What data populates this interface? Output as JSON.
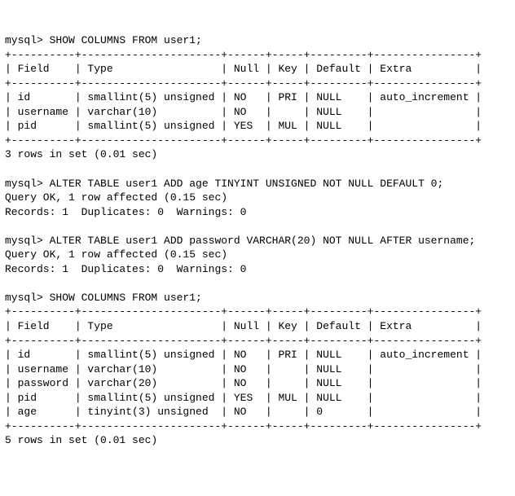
{
  "prompt": "mysql>",
  "sql": {
    "show1": "SHOW COLUMNS FROM user1;",
    "alter1": "ALTER TABLE user1 ADD age TINYINT UNSIGNED NOT NULL DEFAULT 0;",
    "alter2": "ALTER TABLE user1 ADD password VARCHAR(20) NOT NULL AFTER username;",
    "show2": "SHOW COLUMNS FROM user1;"
  },
  "headers": {
    "field": "Field",
    "type": "Type",
    "null": "Null",
    "key": "Key",
    "default": "Default",
    "extra": "Extra"
  },
  "chart_data": [
    {
      "type": "table",
      "title": "SHOW COLUMNS FROM user1 (before ALTER)",
      "columns": [
        "Field",
        "Type",
        "Null",
        "Key",
        "Default",
        "Extra"
      ],
      "rows": [
        {
          "Field": "id",
          "Type": "smallint(5) unsigned",
          "Null": "NO",
          "Key": "PRI",
          "Default": "NULL",
          "Extra": "auto_increment"
        },
        {
          "Field": "username",
          "Type": "varchar(10)",
          "Null": "NO",
          "Key": "",
          "Default": "NULL",
          "Extra": ""
        },
        {
          "Field": "pid",
          "Type": "smallint(5) unsigned",
          "Null": "YES",
          "Key": "MUL",
          "Default": "NULL",
          "Extra": ""
        }
      ]
    },
    {
      "type": "table",
      "title": "SHOW COLUMNS FROM user1 (after ALTER)",
      "columns": [
        "Field",
        "Type",
        "Null",
        "Key",
        "Default",
        "Extra"
      ],
      "rows": [
        {
          "Field": "id",
          "Type": "smallint(5) unsigned",
          "Null": "NO",
          "Key": "PRI",
          "Default": "NULL",
          "Extra": "auto_increment"
        },
        {
          "Field": "username",
          "Type": "varchar(10)",
          "Null": "NO",
          "Key": "",
          "Default": "NULL",
          "Extra": ""
        },
        {
          "Field": "password",
          "Type": "varchar(20)",
          "Null": "NO",
          "Key": "",
          "Default": "NULL",
          "Extra": ""
        },
        {
          "Field": "pid",
          "Type": "smallint(5) unsigned",
          "Null": "YES",
          "Key": "MUL",
          "Default": "NULL",
          "Extra": ""
        },
        {
          "Field": "age",
          "Type": "tinyint(3) unsigned",
          "Null": "NO",
          "Key": "",
          "Default": "0",
          "Extra": ""
        }
      ]
    }
  ],
  "status": {
    "rows1": "3 rows in set (0.01 sec)",
    "ok1_line1": "Query OK, 1 row affected (0.15 sec)",
    "ok1_line2": "Records: 1  Duplicates: 0  Warnings: 0",
    "ok2_line1": "Query OK, 1 row affected (0.15 sec)",
    "ok2_line2": "Records: 1  Duplicates: 0  Warnings: 0",
    "rows2": "5 rows in set (0.01 sec)"
  },
  "widths": {
    "field": 10,
    "type": 22,
    "null": 6,
    "key": 5,
    "default": 9,
    "extra": 16
  }
}
